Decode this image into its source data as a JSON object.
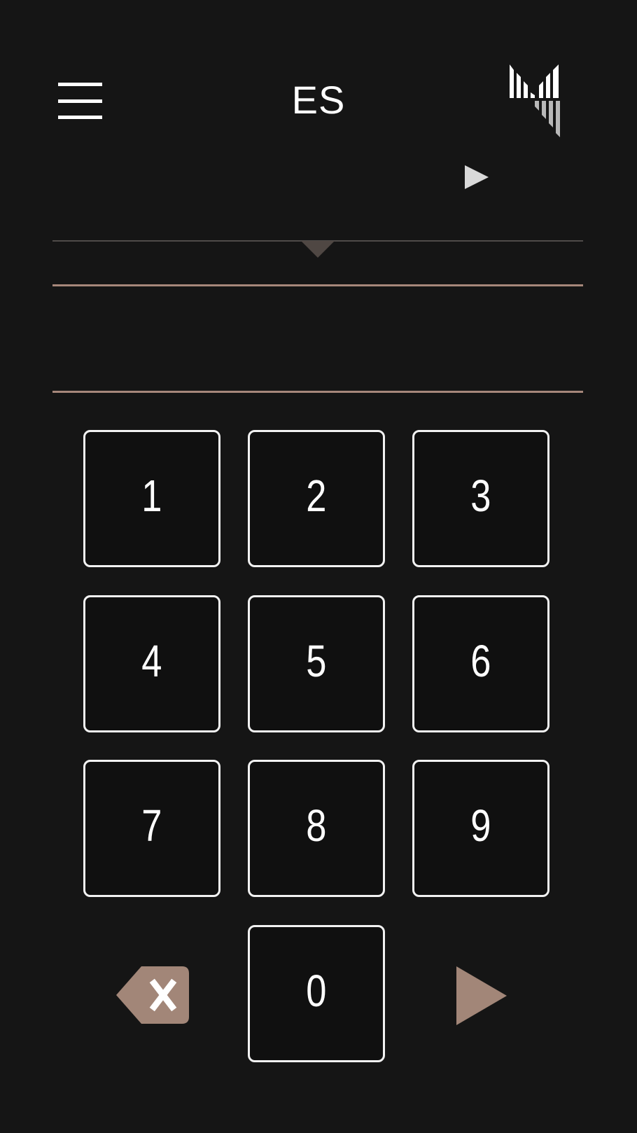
{
  "header": {
    "language": "ES",
    "menu_icon": "hamburger-menu-icon",
    "logo_icon": "brand-logo-icon"
  },
  "pin": {
    "value": "",
    "play_icon": "play-icon"
  },
  "keypad": {
    "keys": [
      "1",
      "2",
      "3",
      "4",
      "5",
      "6",
      "7",
      "8",
      "9",
      "0"
    ],
    "backspace_icon": "backspace-icon",
    "submit_icon": "submit-arrow-icon"
  },
  "colors": {
    "background": "#151515",
    "accent": "#a6877a",
    "divider": "#4f4b49",
    "key_border": "#f2f2f2",
    "text": "#ffffff"
  }
}
